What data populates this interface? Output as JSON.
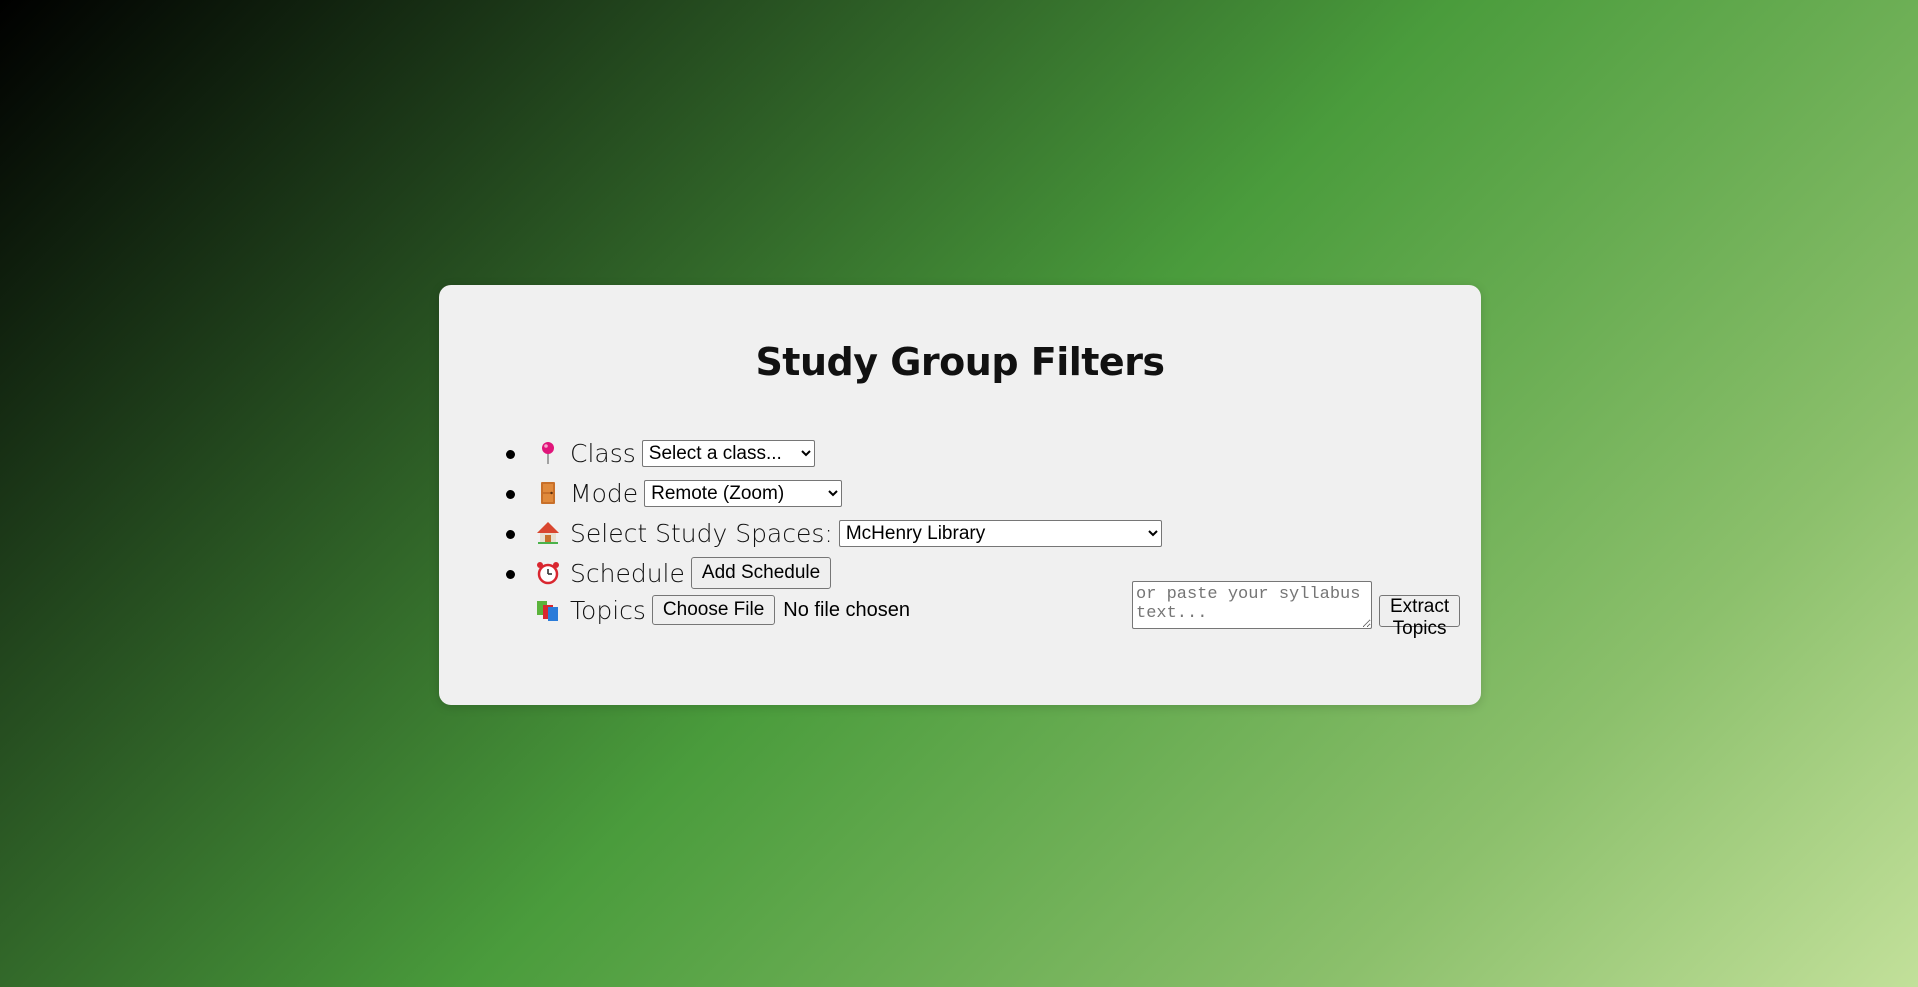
{
  "card": {
    "title": "Study Group Filters"
  },
  "filters": {
    "class": {
      "icon": "pushpin-icon",
      "label": "Class",
      "selected": "Select a class..."
    },
    "mode": {
      "icon": "door-icon",
      "label": "Mode",
      "selected": "Remote (Zoom)"
    },
    "study_spaces": {
      "icon": "house-icon",
      "label": "Select Study Spaces:",
      "selected": "McHenry Library"
    },
    "schedule": {
      "icon": "alarm-clock-icon",
      "label": "Schedule",
      "button_label": "Add Schedule"
    },
    "topics": {
      "icon": "books-icon",
      "label": "Topics",
      "file_button_label": "Choose File",
      "file_status": "No file chosen",
      "syllabus_placeholder": "or paste your syllabus text...",
      "extract_button_label": "Extract Topics"
    }
  },
  "colors": {
    "card_background": "#f0f0f0",
    "gradient_start": "#000000",
    "gradient_mid": "#4a9c3c",
    "gradient_end": "#c2e09a"
  }
}
